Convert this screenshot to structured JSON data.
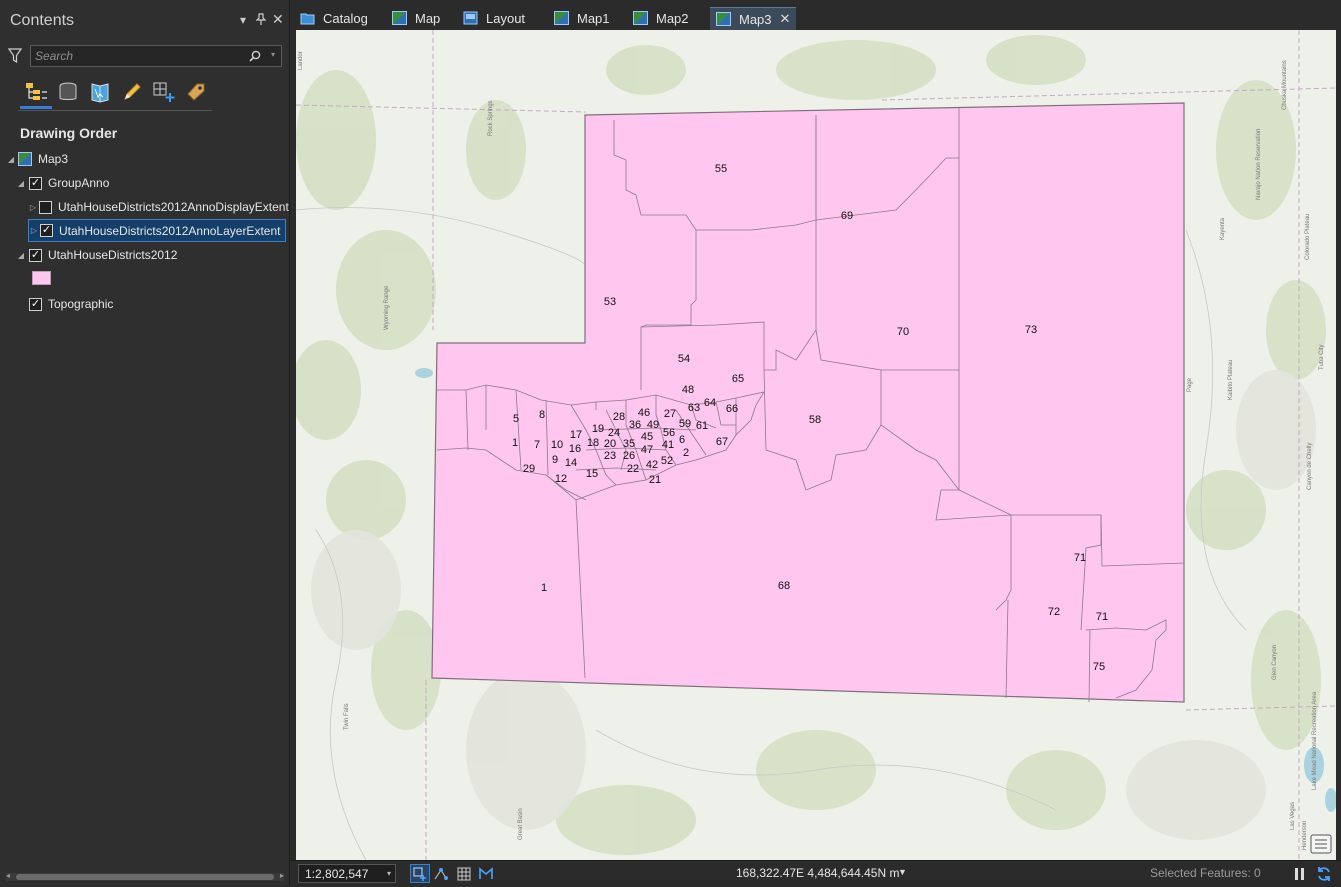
{
  "contents": {
    "title": "Contents",
    "search_placeholder": "Search",
    "drawing_order_label": "Drawing Order",
    "view_tools": [
      "list-by-drawing-order-icon",
      "list-by-source-icon",
      "list-by-selection-icon",
      "list-by-editing-icon",
      "list-by-snapping-icon",
      "list-by-labeling-icon"
    ],
    "tree": [
      {
        "label": "Map3",
        "level": 0,
        "type": "map",
        "expanded": true
      },
      {
        "label": "GroupAnno",
        "level": 1,
        "checked": true,
        "expanded": true
      },
      {
        "label": "UtahHouseDistricts2012AnnoDisplayExtent",
        "level": 2,
        "checked": false,
        "expanded": false
      },
      {
        "label": "UtahHouseDistricts2012AnnoLayerExtent",
        "level": 2,
        "checked": true,
        "expanded": false,
        "selected": true
      },
      {
        "label": "UtahHouseDistricts2012",
        "level": 1,
        "checked": true,
        "expanded": true
      },
      {
        "label": "Topographic",
        "level": 1,
        "checked": true
      }
    ],
    "legend_swatch_color": "#ffc6f0"
  },
  "tabs": [
    {
      "label": "Catalog",
      "icon": "catalog-icon"
    },
    {
      "label": "Map",
      "icon": "map-icon"
    },
    {
      "label": "Layout",
      "icon": "layout-icon"
    },
    {
      "label": "Map1",
      "icon": "map-icon"
    },
    {
      "label": "Map2",
      "icon": "map-icon"
    },
    {
      "label": "Map3",
      "icon": "map-icon",
      "active": true,
      "closable": true
    }
  ],
  "map": {
    "district_fill": "#ffc6f0",
    "district_outline": "#7f6f7c",
    "district_labels": [
      "55",
      "69",
      "53",
      "70",
      "73",
      "54",
      "65",
      "48",
      "64",
      "63",
      "66",
      "5",
      "8",
      "28",
      "46",
      "27",
      "36",
      "49",
      "59",
      "61",
      "58",
      "19",
      "17",
      "24",
      "56",
      "45",
      "6",
      "67",
      "1",
      "7",
      "10",
      "16",
      "18",
      "20",
      "35",
      "47",
      "41",
      "2",
      "9",
      "14",
      "23",
      "26",
      "52",
      "29",
      "22",
      "42",
      "12",
      "15",
      "21",
      "1",
      "68",
      "71",
      "72",
      "71",
      "75"
    ],
    "basemap_labels": [
      "Landor",
      "Rock Springs",
      "Wyoming Range",
      "Kayenta",
      "Tuba City",
      "Page",
      "Kaibito Plateau",
      "Colorado Plateau",
      "Great Basin",
      "Twin Falls",
      "Las Vegas",
      "Henderson",
      "Lake Mead National Recreation Area",
      "Canyon de Chelly",
      "Chuska Mountains",
      "Navajo Nation Reservation",
      "Glen Canyon"
    ]
  },
  "status": {
    "scale": "1:2,802,547",
    "coordinates": "168,322.47E 4,484,644.45N m",
    "selected_features": "Selected Features: 0"
  }
}
